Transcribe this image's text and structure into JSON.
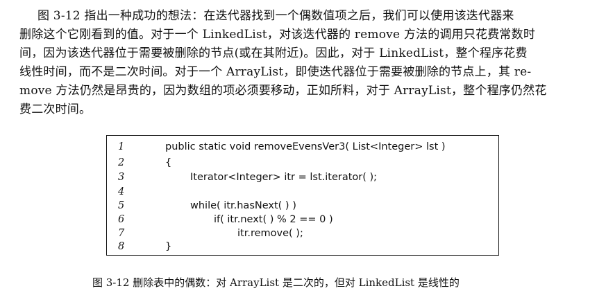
{
  "paragraph": {
    "lines": [
      "图 3-12 指出一种成功的想法：在迭代器找到一个偶数值项之后，我们可以使用该迭代器来",
      "删除这个它刚看到的值。对于一个 LinkedList，对该迭代器的 remove 方法的调用只花费常数时",
      "间，因为该迭代器位于需要被删除的节点(或在其附近)。因此，对于 LinkedList，整个程序花费",
      "线性时间，而不是二次时间。对于一个 ArrayList，即使迭代器位于需要被删除的节点上，其 re-",
      "move 方法仍然是昂贵的，因为数组的项必须要移动，正如所料，对于 ArrayList，整个程序仍然花",
      "费二次时间。"
    ]
  },
  "code": {
    "lines": [
      {
        "number": "1",
        "text": "public static void removeEvensVer3( List<Integer> lst )"
      },
      {
        "number": "2",
        "text": "{"
      },
      {
        "number": "3",
        "text": "Iterator<Integer> itr = lst.iterator( );"
      },
      {
        "number": "4",
        "text": ""
      },
      {
        "number": "5",
        "text": "while( itr.hasNext( ) )"
      },
      {
        "number": "6",
        "text": "if( itr.next( ) % 2 == 0 )"
      },
      {
        "number": "7",
        "text": "itr.remove( );"
      },
      {
        "number": "8",
        "text": "}"
      }
    ]
  },
  "caption": {
    "text": "图 3-12   删除表中的偶数：对 ArrayList 是二次的，但对 LinkedList 是线性的"
  }
}
